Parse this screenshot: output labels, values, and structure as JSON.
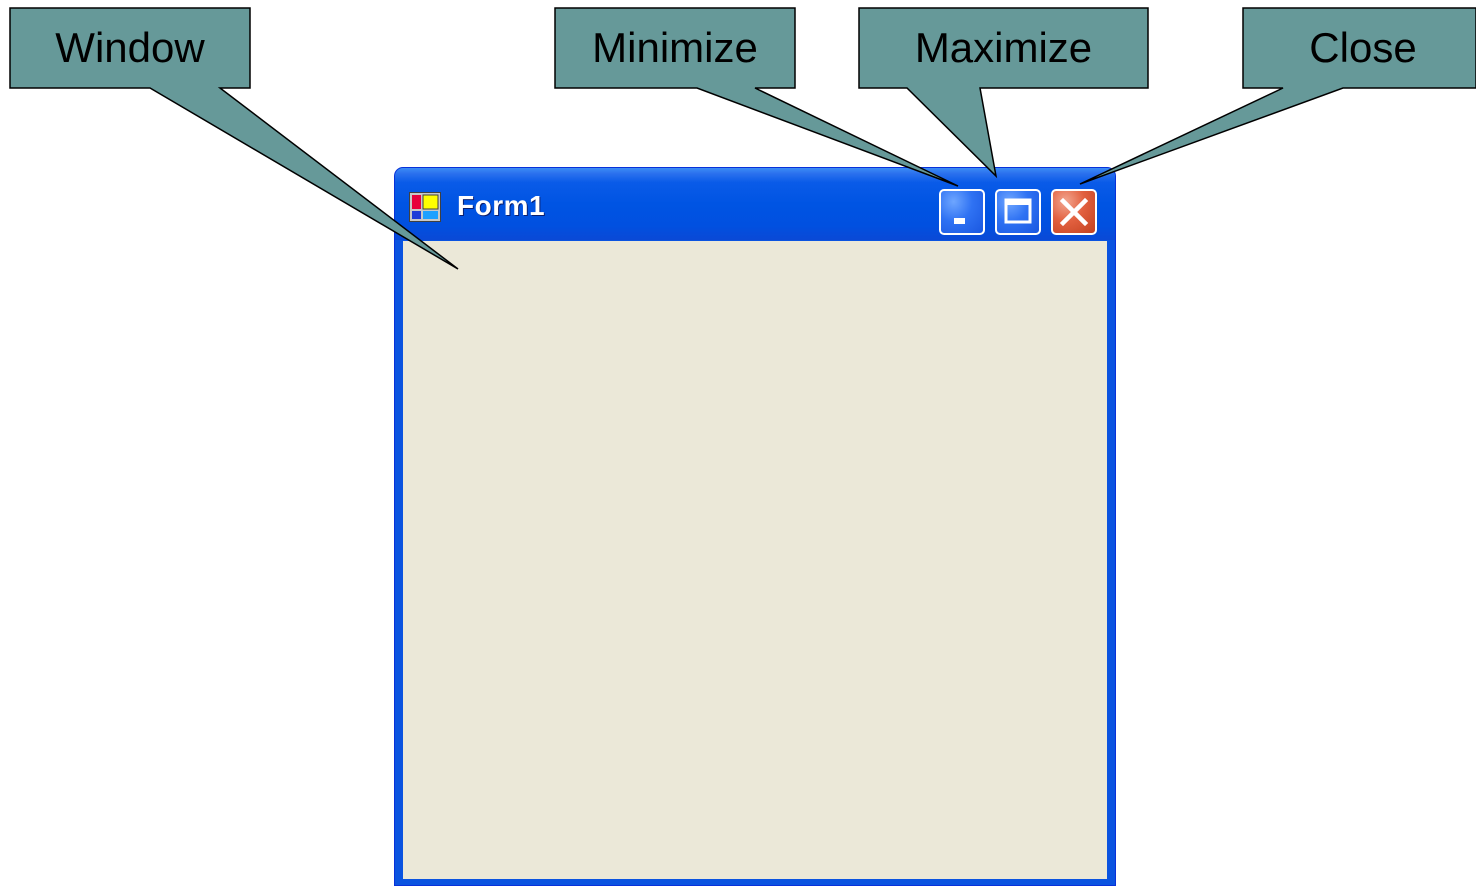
{
  "callouts": {
    "window": "Window",
    "minimize": "Minimize",
    "maximize": "Maximize",
    "close": "Close"
  },
  "window": {
    "title": "Form1"
  },
  "colors": {
    "callout_fill": "#669999",
    "callout_stroke": "#000000",
    "titlebar": "#0054e3",
    "frame": "#0a53e0",
    "client": "#ebe8d8",
    "close_button": "#e2603f"
  },
  "icons": {
    "app": "form-app-icon",
    "minimize": "minimize-icon",
    "maximize": "maximize-icon",
    "close": "close-icon"
  }
}
